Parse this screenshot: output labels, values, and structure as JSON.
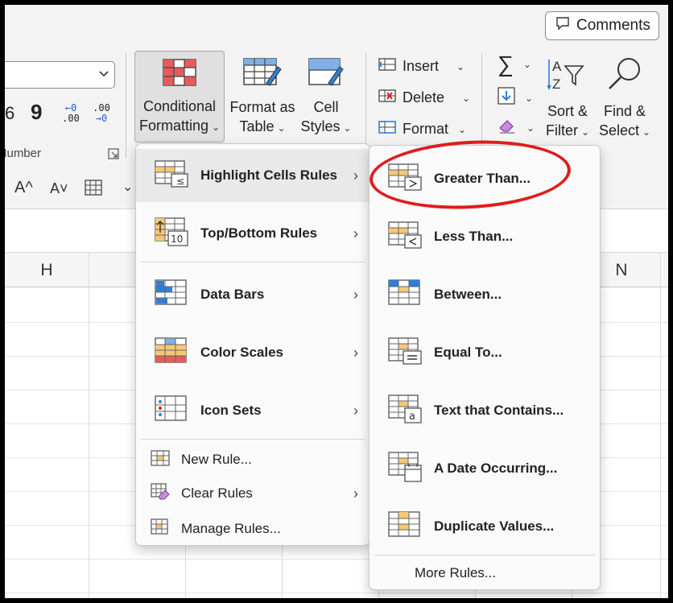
{
  "header": {
    "comments_label": "Comments"
  },
  "ribbon": {
    "number_group_label": "Number",
    "number_glyphs": {
      "percent_partial": "6",
      "comma": "9"
    },
    "increase_decimal": {
      "top": "←0",
      "bottom": ".00"
    },
    "decrease_decimal": {
      "top": ".00",
      "bottom": "→0"
    },
    "conditional_formatting": {
      "line1": "Conditional",
      "line2": "Formatting"
    },
    "format_as_table": {
      "line1": "Format as",
      "line2": "Table"
    },
    "cell_styles": {
      "line1": "Cell",
      "line2": "Styles"
    },
    "insert_label": "Insert",
    "delete_label": "Delete",
    "format_label": "Format",
    "sort_filter": {
      "line1": "Sort &",
      "line2": "Filter"
    },
    "find_select": {
      "line1": "Find &",
      "line2": "Select"
    },
    "sigma": "∑",
    "font_increase": "A^",
    "font_decrease": "A˅"
  },
  "sheet": {
    "columns": [
      "H",
      "N"
    ]
  },
  "cf_menu": {
    "items": [
      {
        "label": "Highlight Cells Rules",
        "has_submenu": true
      },
      {
        "label": "Top/Bottom Rules",
        "has_submenu": true
      },
      {
        "label": "Data Bars",
        "has_submenu": true
      },
      {
        "label": "Color Scales",
        "has_submenu": true
      },
      {
        "label": "Icon Sets",
        "has_submenu": true
      }
    ],
    "commands": [
      {
        "label": "New Rule..."
      },
      {
        "label": "Clear Rules",
        "has_submenu": true
      },
      {
        "label": "Manage Rules..."
      }
    ]
  },
  "highlight_menu": {
    "items": [
      {
        "label": "Greater Than...",
        "icon": "greater-than-icon"
      },
      {
        "label": "Less Than...",
        "icon": "less-than-icon"
      },
      {
        "label": "Between...",
        "icon": "between-icon"
      },
      {
        "label": "Equal To...",
        "icon": "equal-to-icon"
      },
      {
        "label": "Text that Contains...",
        "icon": "text-contains-icon"
      },
      {
        "label": "A Date Occurring...",
        "icon": "date-occurring-icon"
      },
      {
        "label": "Duplicate Values...",
        "icon": "duplicate-values-icon"
      }
    ],
    "more_rules": "More Rules..."
  },
  "colors": {
    "accent_red": "#e01c1c",
    "icon_orange": "#f7c873",
    "icon_blue": "#2f7fd8"
  }
}
